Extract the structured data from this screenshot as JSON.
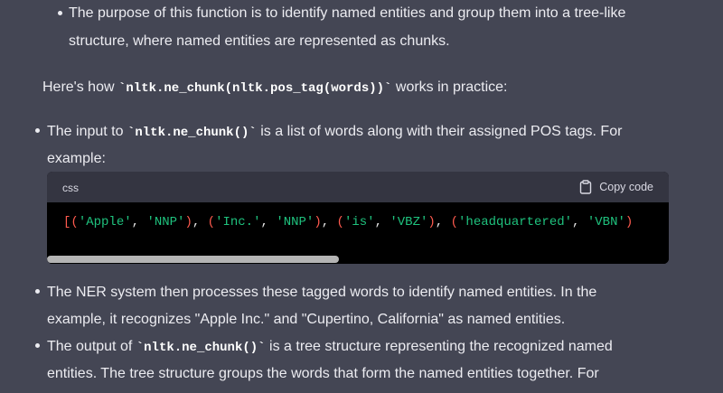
{
  "intro": {
    "line1": "The purpose of this function is to identify named entities and group them into a tree-like",
    "line2": "structure, where named entities are represented as chunks."
  },
  "how": {
    "prefix": "Here's how ",
    "code": "nltk.ne_chunk(nltk.pos_tag(words))",
    "suffix": " works in practice:"
  },
  "input_item": {
    "prefix": "The input to ",
    "code": "nltk.ne_chunk()",
    "suffix": " is a list of words along with their assigned POS tags. For",
    "line2": "example:"
  },
  "code_block": {
    "language": "css",
    "copy_label": "Copy code",
    "tokens": [
      {
        "t": "[",
        "k": "punc"
      },
      {
        "t": "(",
        "k": "punc"
      },
      {
        "t": "'Apple'",
        "k": "str"
      },
      {
        "t": ", ",
        "k": "sep"
      },
      {
        "t": "'NNP'",
        "k": "str"
      },
      {
        "t": ")",
        "k": "punc"
      },
      {
        "t": ", ",
        "k": "sep"
      },
      {
        "t": "(",
        "k": "punc"
      },
      {
        "t": "'Inc.'",
        "k": "str"
      },
      {
        "t": ", ",
        "k": "sep"
      },
      {
        "t": "'NNP'",
        "k": "str"
      },
      {
        "t": ")",
        "k": "punc"
      },
      {
        "t": ", ",
        "k": "sep"
      },
      {
        "t": "(",
        "k": "punc"
      },
      {
        "t": "'is'",
        "k": "str"
      },
      {
        "t": ", ",
        "k": "sep"
      },
      {
        "t": "'VBZ'",
        "k": "str"
      },
      {
        "t": ")",
        "k": "punc"
      },
      {
        "t": ", ",
        "k": "sep"
      },
      {
        "t": "(",
        "k": "punc"
      },
      {
        "t": "'headquartered'",
        "k": "str"
      },
      {
        "t": ", ",
        "k": "sep"
      },
      {
        "t": "'VBN'",
        "k": "str"
      },
      {
        "t": ")",
        "k": "punc"
      }
    ],
    "scroll_fraction": 0.47
  },
  "ner_item": {
    "line1": "The NER system then processes these tagged words to identify named entities. In the",
    "line2": "example, it recognizes \"Apple Inc.\" and \"Cupertino, California\" as named entities."
  },
  "output_item": {
    "prefix": "The output of ",
    "code": "nltk.ne_chunk()",
    "suffix": " is a tree structure representing the recognized named",
    "line2": "entities. The tree structure groups the words that form the named entities together. For"
  },
  "colors": {
    "background": "#444654",
    "text": "#ececf1",
    "code_background": "#000000",
    "code_header": "#343541",
    "string_token": "#1fc27e",
    "punct_token": "#ff5a4e"
  },
  "icons": {
    "copy": "clipboard-icon"
  }
}
